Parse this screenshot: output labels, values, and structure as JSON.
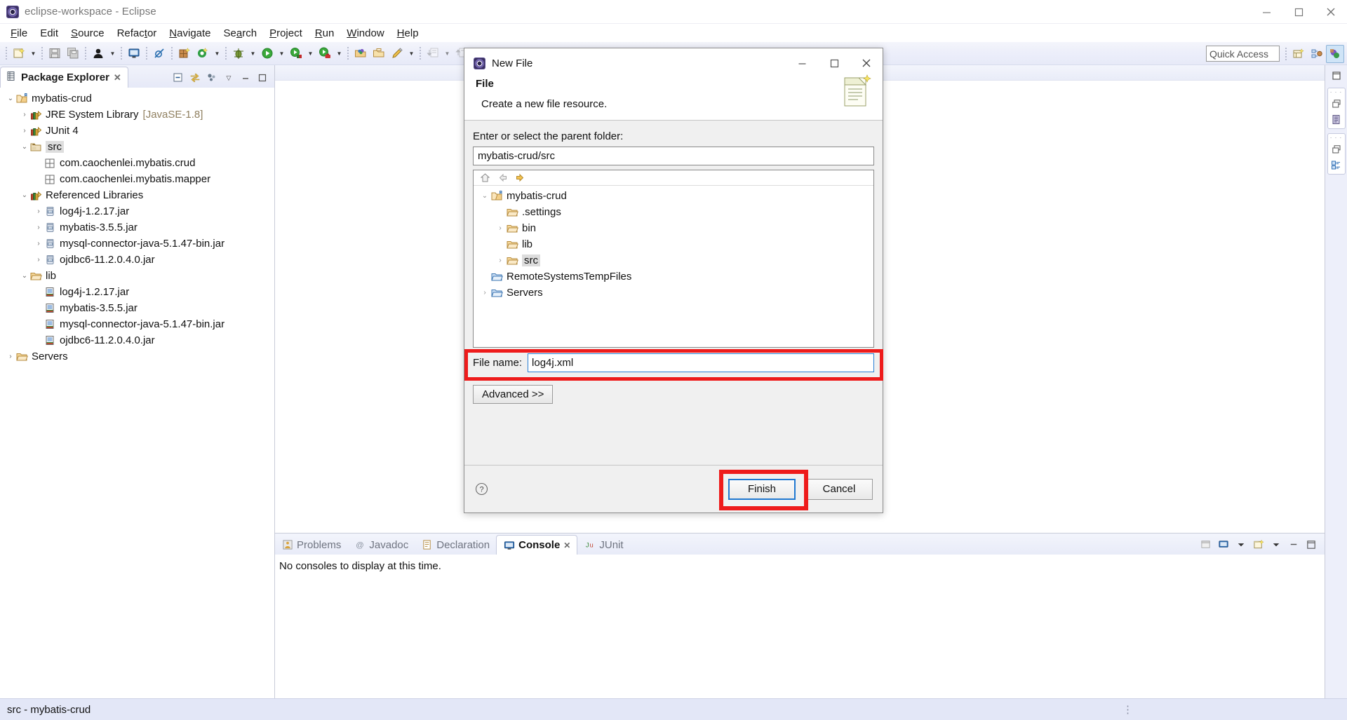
{
  "window": {
    "title": "eclipse-workspace - Eclipse",
    "app_icon": "eclipse-icon",
    "minimize": "minimize-button",
    "maximize": "maximize-button",
    "close": "close-button"
  },
  "menubar": {
    "items": [
      {
        "label": "File",
        "mnemonic": "F"
      },
      {
        "label": "Edit",
        "mnemonic": "E"
      },
      {
        "label": "Source",
        "mnemonic": "S"
      },
      {
        "label": "Refactor",
        "mnemonic": "t"
      },
      {
        "label": "Navigate",
        "mnemonic": "N"
      },
      {
        "label": "Search",
        "mnemonic": "a"
      },
      {
        "label": "Project",
        "mnemonic": "P"
      },
      {
        "label": "Run",
        "mnemonic": "R"
      },
      {
        "label": "Window",
        "mnemonic": "W"
      },
      {
        "label": "Help",
        "mnemonic": "H"
      }
    ]
  },
  "toolbar": {
    "quick_access_placeholder": "Quick Access",
    "quick_access_value": "Quick Access",
    "icons": [
      "new-wizard-icon",
      "save-icon",
      "save-all-icon",
      "user-icon",
      "console-view-icon",
      "skip-breakpoints-icon",
      "new-java-package-icon",
      "new-java-class-icon",
      "debug-icon",
      "run-icon",
      "run-coverage-icon",
      "run-external-tools-icon",
      "open-type-icon",
      "open-task-icon",
      "annotation-icon",
      "next-annotation-icon",
      "previous-annotation-icon",
      "back-icon",
      "forward-icon"
    ],
    "right_icons": [
      "open-perspective-icon",
      "java-perspective-icon",
      "java-ee-perspective-icon"
    ]
  },
  "package_explorer": {
    "tab_label": "Package Explorer",
    "close_glyph": "close-icon",
    "toolbar_icons": [
      "collapse-all-icon",
      "link-with-editor-icon",
      "view-menu-icon",
      "minimize-icon",
      "maximize-icon"
    ],
    "tree": [
      {
        "indent": 0,
        "twisty": "expanded",
        "icon": "java-project-icon",
        "label": "mybatis-crud",
        "suffix": ""
      },
      {
        "indent": 1,
        "twisty": "collapsed",
        "icon": "library-icon",
        "label": "JRE System Library",
        "suffix": "[JavaSE-1.8]"
      },
      {
        "indent": 1,
        "twisty": "collapsed",
        "icon": "library-icon",
        "label": "JUnit 4",
        "suffix": ""
      },
      {
        "indent": 1,
        "twisty": "expanded",
        "icon": "source-folder-icon",
        "label": "src",
        "suffix": "",
        "selected": true
      },
      {
        "indent": 2,
        "twisty": "none",
        "icon": "package-icon",
        "label": "com.caochenlei.mybatis.crud",
        "suffix": ""
      },
      {
        "indent": 2,
        "twisty": "none",
        "icon": "package-icon",
        "label": "com.caochenlei.mybatis.mapper",
        "suffix": ""
      },
      {
        "indent": 1,
        "twisty": "expanded",
        "icon": "library-icon",
        "label": "Referenced Libraries",
        "suffix": ""
      },
      {
        "indent": 2,
        "twisty": "collapsed",
        "icon": "jar-icon",
        "label": "log4j-1.2.17.jar",
        "suffix": ""
      },
      {
        "indent": 2,
        "twisty": "collapsed",
        "icon": "jar-icon",
        "label": "mybatis-3.5.5.jar",
        "suffix": ""
      },
      {
        "indent": 2,
        "twisty": "collapsed",
        "icon": "jar-icon",
        "label": "mysql-connector-java-5.1.47-bin.jar",
        "suffix": ""
      },
      {
        "indent": 2,
        "twisty": "collapsed",
        "icon": "jar-icon",
        "label": "ojdbc6-11.2.0.4.0.jar",
        "suffix": ""
      },
      {
        "indent": 1,
        "twisty": "expanded",
        "icon": "folder-icon",
        "label": "lib",
        "suffix": ""
      },
      {
        "indent": 2,
        "twisty": "none",
        "icon": "file-jar-icon",
        "label": "log4j-1.2.17.jar",
        "suffix": ""
      },
      {
        "indent": 2,
        "twisty": "none",
        "icon": "file-jar-icon",
        "label": "mybatis-3.5.5.jar",
        "suffix": ""
      },
      {
        "indent": 2,
        "twisty": "none",
        "icon": "file-jar-icon",
        "label": "mysql-connector-java-5.1.47-bin.jar",
        "suffix": ""
      },
      {
        "indent": 2,
        "twisty": "none",
        "icon": "file-jar-icon",
        "label": "ojdbc6-11.2.0.4.0.jar",
        "suffix": ""
      },
      {
        "indent": 0,
        "twisty": "collapsed",
        "icon": "folder-icon",
        "label": "Servers",
        "suffix": ""
      }
    ]
  },
  "bottom_view": {
    "tabs": [
      {
        "label": "Problems",
        "icon": "problems-icon",
        "active": false
      },
      {
        "label": "Javadoc",
        "icon": "javadoc-icon",
        "active": false
      },
      {
        "label": "Declaration",
        "icon": "declaration-icon",
        "active": false
      },
      {
        "label": "Console",
        "icon": "console-icon",
        "active": true
      },
      {
        "label": "JUnit",
        "icon": "junit-icon",
        "active": false
      }
    ],
    "content": "No consoles to display at this time.",
    "toolbar_icons": [
      "open-console-icon",
      "display-selected-console-icon",
      "dropdown-icon",
      "new-console-view-icon",
      "dropdown2-icon",
      "minimize-icon",
      "maximize-icon"
    ]
  },
  "right_rail": {
    "groups": [
      {
        "dots": "· · ·",
        "icon": "restore-icon",
        "glyph": "outline-icon"
      },
      {
        "dots": "· · ·",
        "icon": "restore-icon",
        "glyph": "task-list-icon"
      }
    ],
    "top_button": "maximize-icon"
  },
  "statusbar": {
    "text": "src - mybatis-crud",
    "resize_grip": "resize-grip-icon"
  },
  "dialog": {
    "title": "New File",
    "title_icon": "eclipse-icon",
    "minimize": "minimize-button",
    "maximize": "maximize-button",
    "close": "close-button",
    "heading": "File",
    "description": "Create a new file resource.",
    "banner_icon": "new-file-banner-icon",
    "parent_label": "Enter or select the parent folder:",
    "parent_value": "mybatis-crud/src",
    "nav_icons": [
      "home-icon",
      "back-icon",
      "forward-icon"
    ],
    "tree": [
      {
        "indent": 0,
        "twisty": "expanded",
        "icon": "project-icon",
        "label": "mybatis-crud"
      },
      {
        "indent": 1,
        "twisty": "none",
        "icon": "folder-icon",
        "label": ".settings"
      },
      {
        "indent": 1,
        "twisty": "collapsed",
        "icon": "folder-icon",
        "label": "bin"
      },
      {
        "indent": 1,
        "twisty": "none",
        "icon": "folder-icon",
        "label": "lib"
      },
      {
        "indent": 1,
        "twisty": "collapsed",
        "icon": "folder-icon",
        "label": "src",
        "selected": true
      },
      {
        "indent": 0,
        "twisty": "none",
        "icon": "folder-blue-icon",
        "label": "RemoteSystemsTempFiles"
      },
      {
        "indent": 0,
        "twisty": "collapsed",
        "icon": "folder-blue-icon",
        "label": "Servers"
      }
    ],
    "filename_label": "File name:",
    "filename_value": "log4j.xml",
    "advanced_label": "Advanced >>",
    "help_icon": "help-icon",
    "finish_label": "Finish",
    "cancel_label": "Cancel",
    "highlight_color": "#ee1b1b",
    "focus_color": "#1f78d1"
  }
}
